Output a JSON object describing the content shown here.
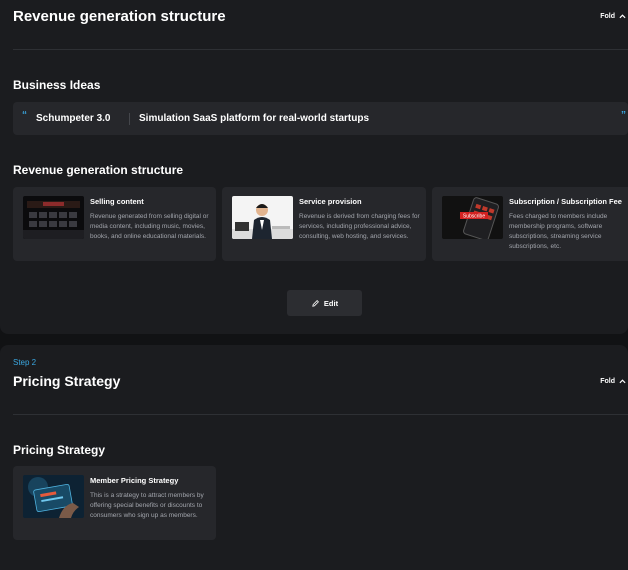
{
  "section1": {
    "header_title": "Revenue generation structure",
    "fold_label": "Fold",
    "business_ideas_title": "Business Ideas",
    "idea": {
      "quote_open": "“",
      "quote_close": "”",
      "name": "Schumpeter 3.0",
      "description": "Simulation SaaS platform for real-world startups"
    },
    "revenue_title": "Revenue generation structure",
    "cards": [
      {
        "title": "Selling content",
        "description": "Revenue generated from selling digital or media content, including music, movies, books, and online educational materials."
      },
      {
        "title": "Service provision",
        "description": "Revenue is derived from charging fees for services, including professional advice, consulting, web hosting, and services."
      },
      {
        "title": "Subscription / Subscription Fee",
        "description": "Fees charged to members include membership programs, software subscriptions, streaming service subscriptions, etc.",
        "thumb_text": "Subscribe"
      }
    ],
    "edit_label": "Edit"
  },
  "section2": {
    "step_label": "Step 2",
    "header_title": "Pricing Strategy",
    "fold_label": "Fold",
    "pricing_title": "Pricing Strategy",
    "cards": [
      {
        "title": "Member Pricing Strategy",
        "description": "This is a strategy to attract members by offering special benefits or discounts to consumers who sign up as members."
      }
    ]
  },
  "colors": {
    "accent": "#3aa7e0",
    "panel": "#1b1c1f",
    "card": "#26272b",
    "muted_text": "#a3a6ad"
  }
}
